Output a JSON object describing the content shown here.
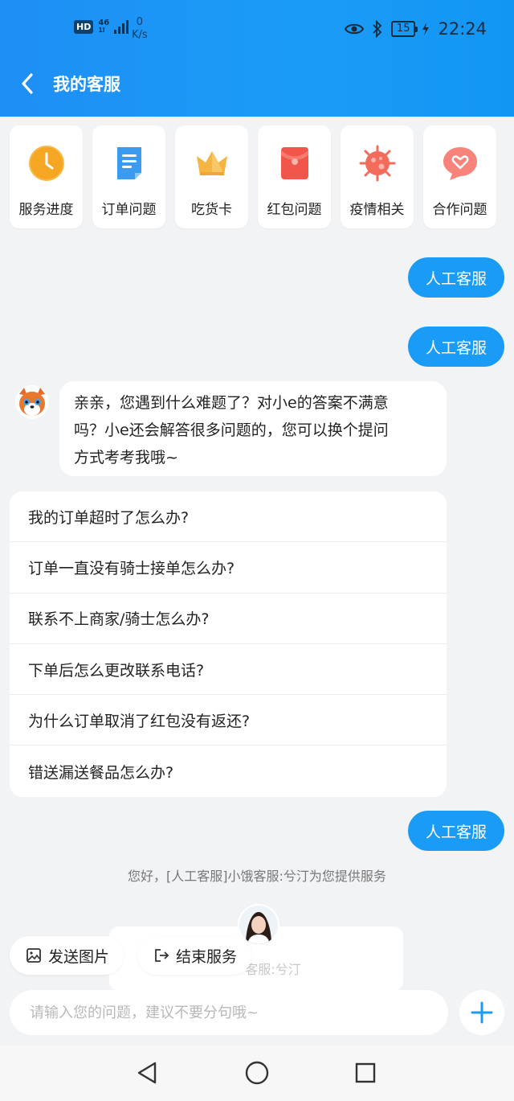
{
  "status_bar": {
    "hd": "HD",
    "network": "46",
    "network_sub": "1l",
    "speed_value": "0",
    "speed_unit": "K/s",
    "battery": "15",
    "time": "22:24"
  },
  "header": {
    "title": "我的客服",
    "back_icon": "chevron-left-icon"
  },
  "quick_menu": [
    {
      "label": "服务进度",
      "icon": "clock-icon",
      "color": "#f5a623"
    },
    {
      "label": "订单问题",
      "icon": "document-icon",
      "color": "#3a9bf0"
    },
    {
      "label": "吃货卡",
      "icon": "crown-icon",
      "color": "#f5b543"
    },
    {
      "label": "红包问题",
      "icon": "red-envelope-icon",
      "color": "#f2564a"
    },
    {
      "label": "疫情相关",
      "icon": "virus-icon",
      "color": "#f26b5b"
    },
    {
      "label": "合作问题",
      "icon": "heart-chat-icon",
      "color": "#f7837a"
    }
  ],
  "messages": {
    "user_1": "人工客服",
    "user_2": "人工客服",
    "bot_line_1": "亲亲，您遇到什么难题了？对小e的答案不满意",
    "bot_line_2": "吗？小e还会解答很多问题的，您可以换个提问",
    "bot_line_3": "方式考考我哦~",
    "user_3": "人工客服",
    "system_note": "您好，[人工客服]小饿客服:兮汀为您提供服务",
    "agent_name": "客服:兮汀"
  },
  "faq": [
    "我的订单超时了怎么办?",
    "订单一直没有骑士接单怎么办?",
    "联系不上商家/骑士怎么办?",
    "下单后怎么更改联系电话?",
    "为什么订单取消了红包没有返还?",
    "错送漏送餐品怎么办?"
  ],
  "actions": {
    "send_image": "发送图片",
    "end_service": "结束服务"
  },
  "input": {
    "placeholder": "请输入您的问题，建议不要分句哦~",
    "value": ""
  },
  "colors": {
    "accent": "#1a9cf6",
    "background": "#f2f3f5"
  }
}
